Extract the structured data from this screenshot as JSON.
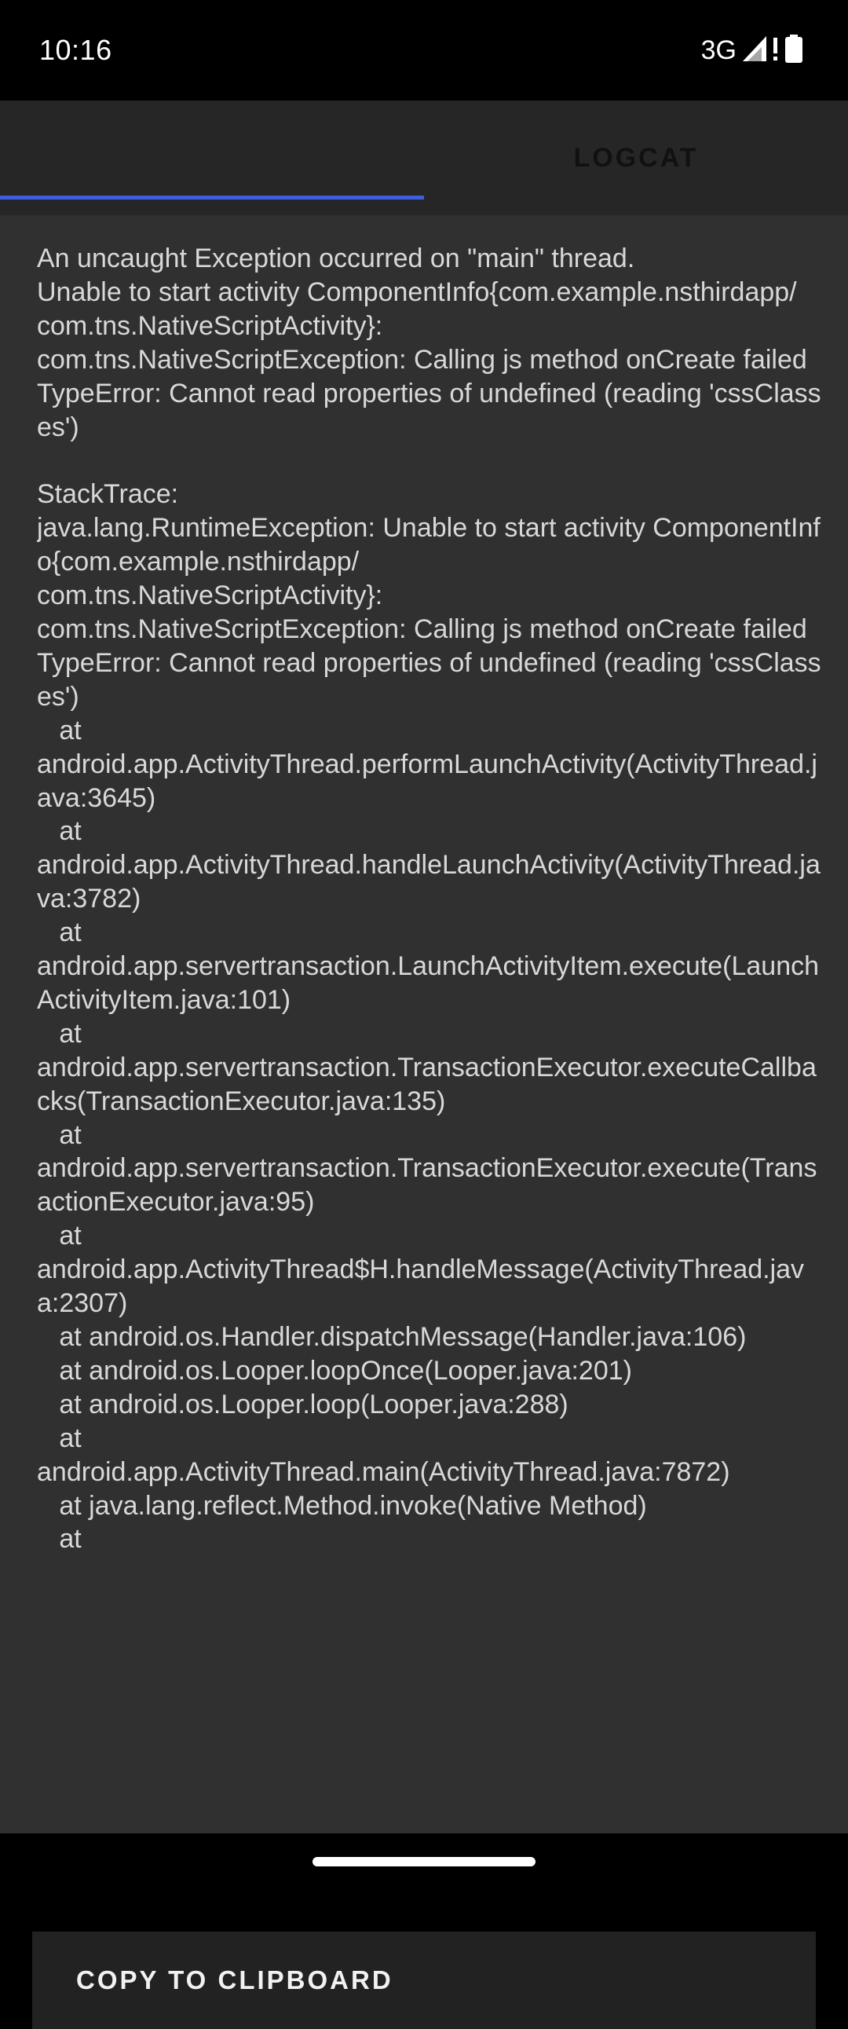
{
  "status_bar": {
    "time": "10:16",
    "network": "3G",
    "icons": [
      "signal-icon",
      "alert-icon",
      "battery-icon"
    ]
  },
  "tabs": [
    {
      "label": "",
      "selected": true
    },
    {
      "label": "LOGCAT",
      "selected": false
    }
  ],
  "colors": {
    "accent": "#3f5fe0",
    "background": "#303030",
    "tab_bar": "#262626",
    "text": "#d8d8d8"
  },
  "error_log": "An uncaught Exception occurred on \"main\" thread.\nUnable to start activity ComponentInfo{com.example.nsthirdapp/\ncom.tns.NativeScriptActivity}:\ncom.tns.NativeScriptException: Calling js method onCreate failed\nTypeError: Cannot read properties of undefined (reading 'cssClasses')\n\nStackTrace:\njava.lang.RuntimeException: Unable to start activity ComponentInfo{com.example.nsthirdapp/\ncom.tns.NativeScriptActivity}:\ncom.tns.NativeScriptException: Calling js method onCreate failed\nTypeError: Cannot read properties of undefined (reading 'cssClasses')\n   at\nandroid.app.ActivityThread.performLaunchActivity(ActivityThread.java:3645)\n   at\nandroid.app.ActivityThread.handleLaunchActivity(ActivityThread.java:3782)\n   at\nandroid.app.servertransaction.LaunchActivityItem.execute(LaunchActivityItem.java:101)\n   at\nandroid.app.servertransaction.TransactionExecutor.executeCallbacks(TransactionExecutor.java:135)\n   at\nandroid.app.servertransaction.TransactionExecutor.execute(TransactionExecutor.java:95)\n   at\nandroid.app.ActivityThread$H.handleMessage(ActivityThread.java:2307)\n   at android.os.Handler.dispatchMessage(Handler.java:106)\n   at android.os.Looper.loopOnce(Looper.java:201)\n   at android.os.Looper.loop(Looper.java:288)\n   at\nandroid.app.ActivityThread.main(ActivityThread.java:7872)\n   at java.lang.reflect.Method.invoke(Native Method)\n   at",
  "copy_button_label": "COPY TO CLIPBOARD"
}
